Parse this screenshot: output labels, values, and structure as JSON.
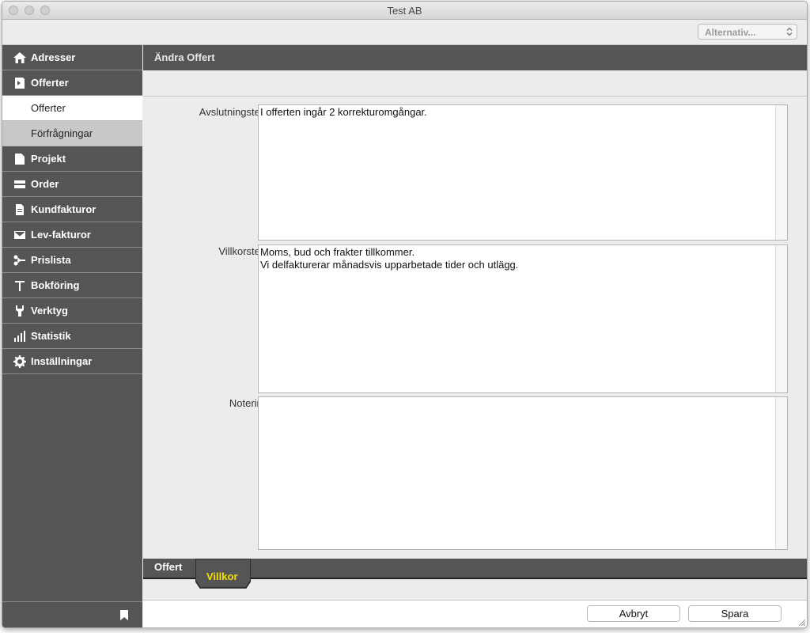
{
  "window": {
    "title": "Test AB"
  },
  "toolbar": {
    "alternativ_label": "Alternativ..."
  },
  "sidebar": {
    "items": [
      {
        "label": "Adresser",
        "icon": "home-icon"
      },
      {
        "label": "Offerter",
        "icon": "offer-document-icon"
      },
      {
        "label": "Projekt",
        "icon": "project-document-icon"
      },
      {
        "label": "Order",
        "icon": "order-icon"
      },
      {
        "label": "Kundfakturor",
        "icon": "customer-invoice-icon"
      },
      {
        "label": "Lev-fakturor",
        "icon": "envelope-icon"
      },
      {
        "label": "Prislista",
        "icon": "price-list-icon"
      },
      {
        "label": "Bokföring",
        "icon": "accounting-icon"
      },
      {
        "label": "Verktyg",
        "icon": "wrench-icon"
      },
      {
        "label": "Statistik",
        "icon": "bar-chart-icon"
      },
      {
        "label": "Inställningar",
        "icon": "gear-icon"
      }
    ],
    "subitems": [
      {
        "label": "Offerter"
      },
      {
        "label": "Förfrågningar"
      }
    ]
  },
  "main": {
    "header": "Ändra Offert",
    "fields": {
      "avslutning_label": "Avslutningstext",
      "avslutning_lines": [
        "I offerten ingår 2 korrekturomgångar."
      ],
      "villkor_label": "Villkorstext",
      "villkor_lines": [
        "Moms, bud och frakter tillkommer.",
        "Vi delfakturerar månadsvis upparbetade tider och utlägg."
      ],
      "notering_label": "Notering"
    },
    "tabs": [
      {
        "label": "Offert"
      },
      {
        "label": "Villkor",
        "active_color": "#f3e000"
      }
    ]
  },
  "footer": {
    "cancel_label": "Avbryt",
    "save_label": "Spara"
  }
}
